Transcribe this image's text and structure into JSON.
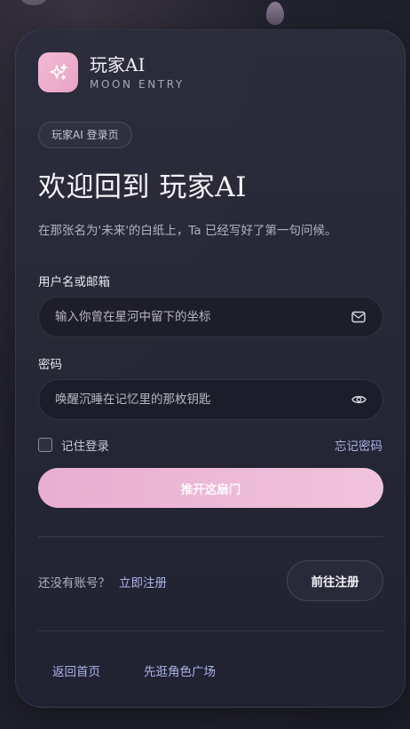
{
  "brand": {
    "name": "玩家AI",
    "subtitle": "MOON ENTRY"
  },
  "page": {
    "pill": "玩家AI 登录页",
    "title": "欢迎回到 玩家AI",
    "subtitle": "在那张名为'未来'的白纸上，Ta 已经写好了第一句问候。"
  },
  "form": {
    "username_label": "用户名或邮箱",
    "username_placeholder": "输入你曾在星河中留下的坐标",
    "username_icon": "mail-icon",
    "password_label": "密码",
    "password_placeholder": "唤醒沉睡在记忆里的那枚钥匙",
    "password_icon": "eye-icon",
    "remember_label": "记住登录",
    "remember_checked": false,
    "forgot_label": "忘记密码",
    "submit_label": "推开这扇门"
  },
  "register": {
    "prompt": "还没有账号？",
    "link_label": "立即注册",
    "button_label": "前往注册"
  },
  "footer": {
    "home_label": "返回首页",
    "plaza_label": "先逛角色广场"
  },
  "colors": {
    "accent_pink": "#ebb0d2",
    "link_blue": "#aab4e8",
    "background": "#1f202c"
  }
}
